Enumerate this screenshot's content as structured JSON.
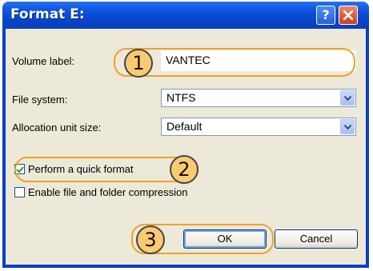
{
  "window": {
    "title": "Format E:"
  },
  "titlebar": {
    "help_label": "?",
    "close_label": "✕"
  },
  "form": {
    "volume_label": {
      "label": "Volume label:",
      "value": "VANTEC"
    },
    "file_system": {
      "label": "File system:",
      "value": "NTFS"
    },
    "allocation_unit_size": {
      "label": "Allocation unit size:",
      "value": "Default"
    }
  },
  "options": {
    "quick_format": {
      "label": "Perform a quick format",
      "checked": true
    },
    "compression": {
      "label": "Enable file and folder compression",
      "checked": false
    }
  },
  "buttons": {
    "ok_label": "OK",
    "cancel_label": "Cancel"
  },
  "callouts": {
    "one": "1",
    "two": "2",
    "three": "3"
  },
  "colors": {
    "callout": "#f0a12a",
    "badge": "#fbca72",
    "titlebar": "#0a52dc"
  }
}
